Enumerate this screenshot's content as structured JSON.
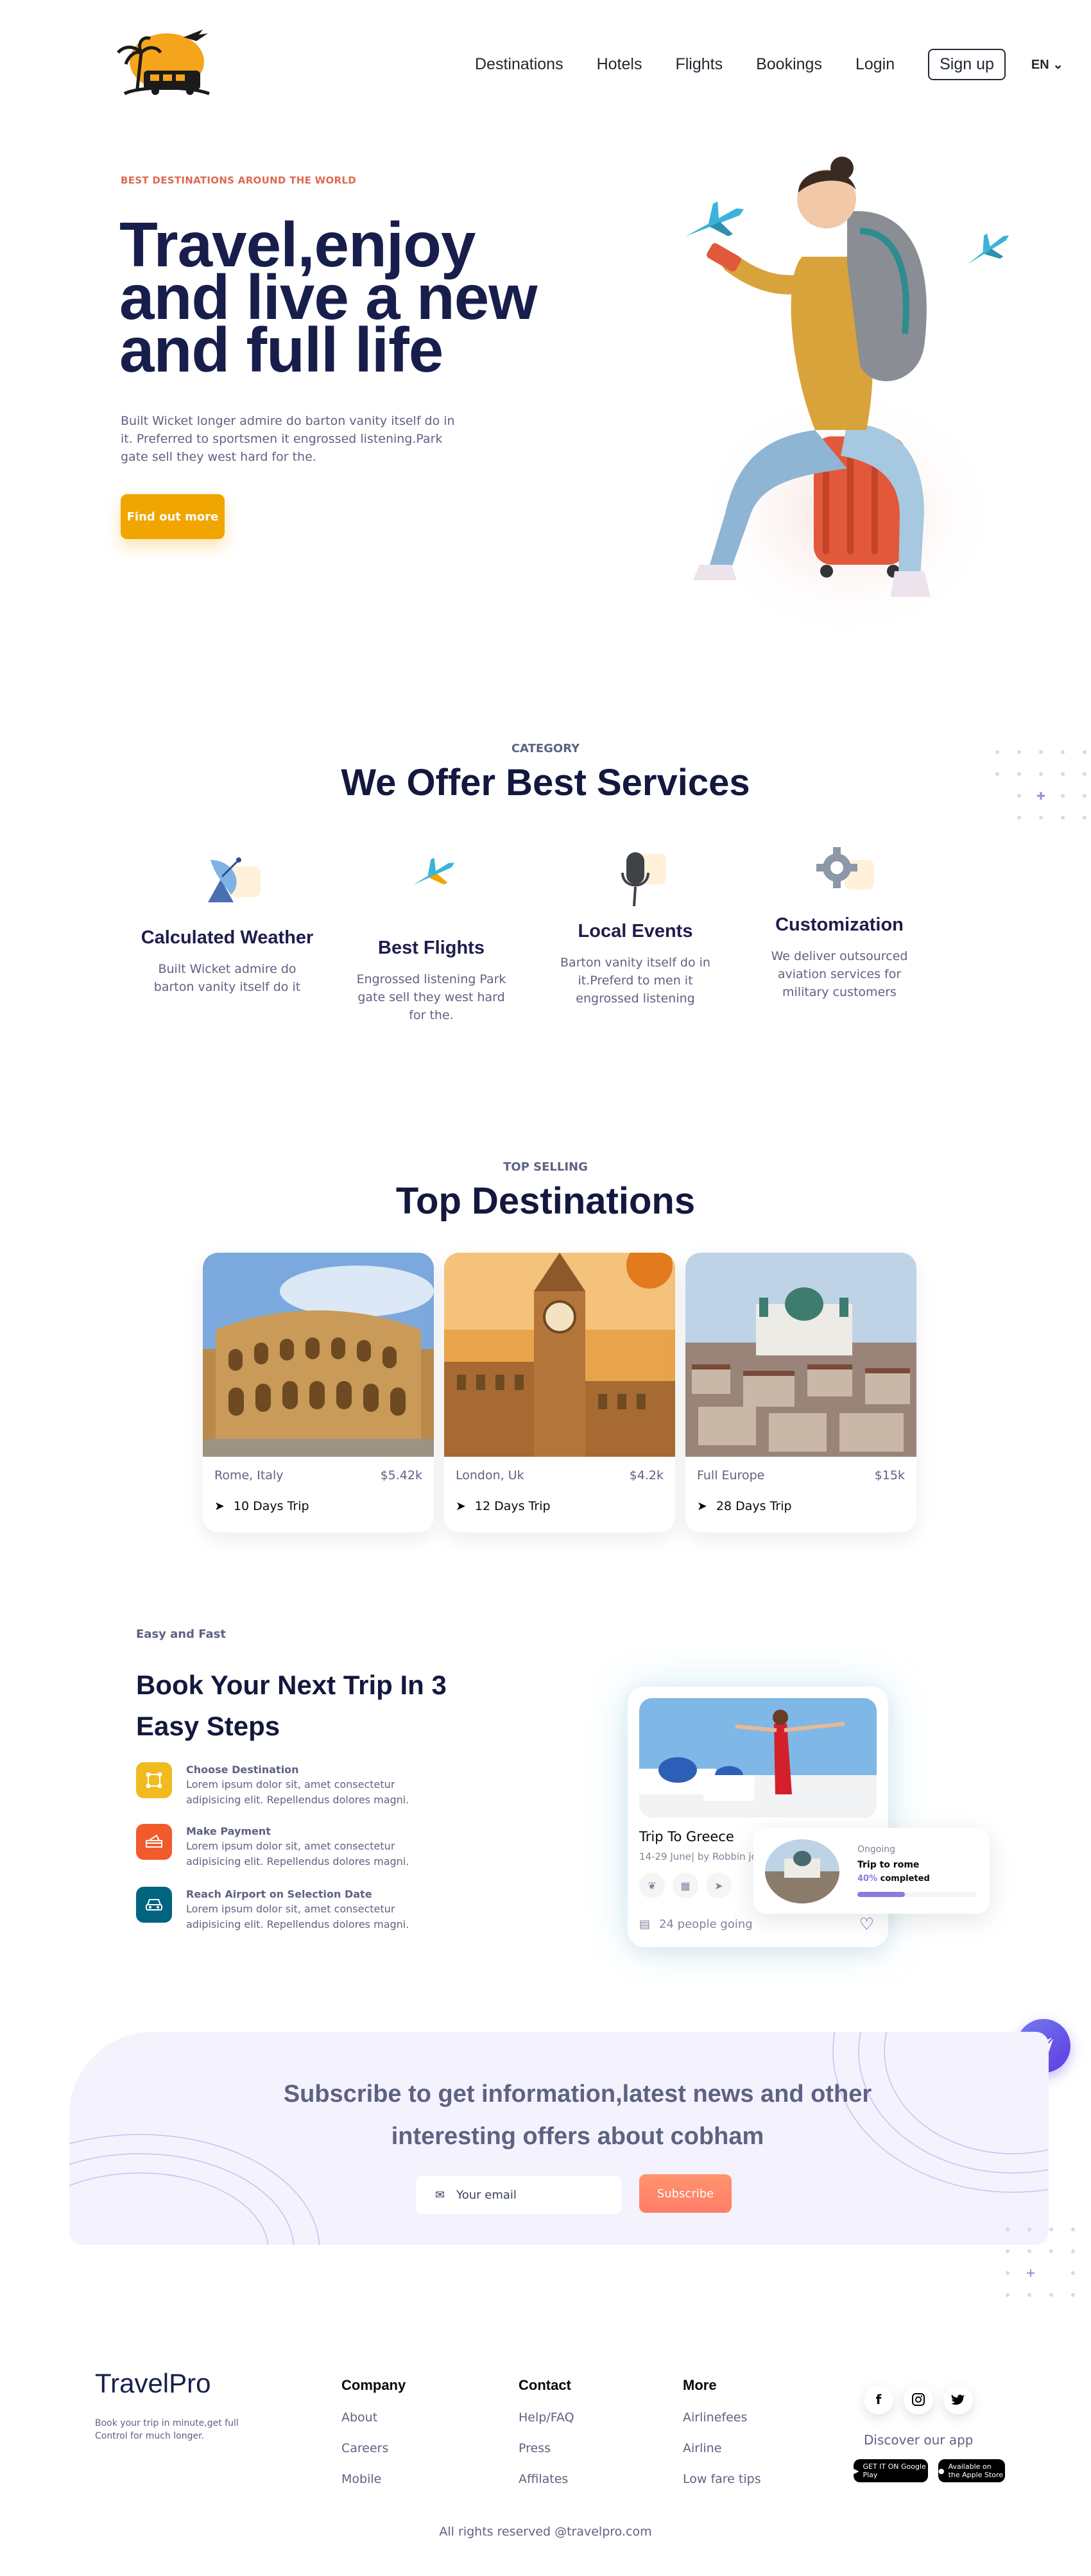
{
  "nav": {
    "items": [
      "Destinations",
      "Hotels",
      "Flights",
      "Bookings",
      "Login"
    ],
    "signup": "Sign up",
    "lang": "EN"
  },
  "hero": {
    "eyebrow": "BEST DESTINATIONS AROUND THE WORLD",
    "title_line1": "Travel,enjoy",
    "title_line2": "and live a new",
    "title_line3": "and full life",
    "description": "Built Wicket longer admire do barton vanity itself do in it. Preferred to sportsmen it engrossed listening.Park gate sell they west hard for the.",
    "cta": "Find out more"
  },
  "services": {
    "eyebrow": "CATEGORY",
    "title": "We Offer Best Services",
    "items": [
      {
        "title": "Calculated Weather",
        "text": "Built Wicket admire do barton vanity itself do it",
        "icon": "satellite-icon"
      },
      {
        "title": "Best Flights",
        "text": "Engrossed listening Park gate sell they west hard for the.",
        "icon": "airplane-icon"
      },
      {
        "title": "Local Events",
        "text": "Barton vanity itself do in it.Preferd to men it engrossed listening",
        "icon": "microphone-icon"
      },
      {
        "title": "Customization",
        "text": "We deliver outsourced aviation services for military customers",
        "icon": "gear-icon"
      }
    ]
  },
  "destinations": {
    "eyebrow": "TOP SELLING",
    "title": "Top Destinations",
    "items": [
      {
        "place": "Rome, Italy",
        "price": "$5.42k",
        "trip": "10 Days Trip"
      },
      {
        "place": "London, Uk",
        "price": "$4.2k",
        "trip": "12 Days Trip"
      },
      {
        "place": "Full Europe",
        "price": "$15k",
        "trip": "28 Days Trip"
      }
    ]
  },
  "steps": {
    "eyebrow": "Easy and Fast",
    "title": "Book Your Next Trip In 3 Easy Steps",
    "items": [
      {
        "title": "Choose Destination",
        "text": "Lorem ipsum dolor sit, amet consectetur adipisicing elit. Repellendus dolores magni.",
        "color": "#F0BB1F"
      },
      {
        "title": "Make Payment",
        "text": "Lorem ipsum dolor sit, amet consectetur adipisicing elit. Repellendus dolores magni.",
        "color": "#F15A2B"
      },
      {
        "title": "Reach Airport on Selection Date",
        "text": "Lorem ipsum dolor sit, amet consectetur adipisicing elit. Repellendus dolores magni.",
        "color": "#006380"
      }
    ],
    "card": {
      "name": "Trip To Greece",
      "sub": "14-29 June| by Robbin jo",
      "people": "24 people going"
    },
    "ongoing": {
      "label": "Ongoing",
      "title": "Trip to rome",
      "percent": "40%",
      "completed": "completed",
      "progress": 0.4
    }
  },
  "subscribe": {
    "title": "Subscribe to get information,latest news and other interesting offers about cobham",
    "email_placeholder": "Your email",
    "button": "Subscribe"
  },
  "footer": {
    "brand": "TravelPro",
    "tagline": "Book your trip in minute,get full Control for much longer.",
    "columns": [
      {
        "title": "Company",
        "links": [
          "About",
          "Careers",
          "Mobile"
        ]
      },
      {
        "title": "Contact",
        "links": [
          "Help/FAQ",
          "Press",
          "Affilates"
        ]
      },
      {
        "title": "More",
        "links": [
          "Airlinefees",
          "Airline",
          "Low fare tips"
        ]
      }
    ],
    "social": [
      "f",
      "ig",
      "tw"
    ],
    "discover": "Discover our app",
    "google_play": "GET IT ON Google Play",
    "app_store": "Available on the Apple Store",
    "copyright": "All rights reserved @travelpro.com"
  },
  "colors": {
    "primary": "#181E4B",
    "accent": "#F1A501",
    "eyebrow": "#DF6951",
    "muted": "#5E6282",
    "purple": "#8A79DF"
  }
}
